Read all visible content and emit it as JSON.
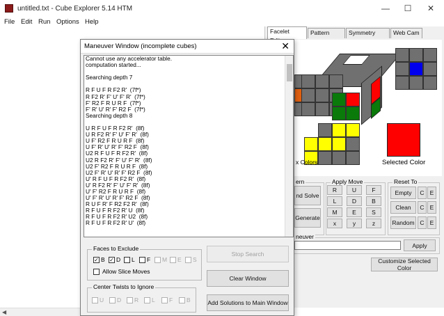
{
  "window": {
    "title": "untitled.txt - Cube Explorer 5.14 HTM",
    "min": "—",
    "max": "☐",
    "close": "✕"
  },
  "menu": [
    "File",
    "Edit",
    "Run",
    "Options",
    "Help"
  ],
  "tabs": [
    "Facelet Editor",
    "Pattern Editor",
    "Symmetry Editor",
    "Web Cam"
  ],
  "right": {
    "colors_label": "x Colors",
    "selected_color_label": "Selected Color",
    "selected_color": "#ff0000",
    "pattern_group": "ern",
    "solve_btn": "nd Solve",
    "generate_btn": "Generate",
    "apply_move_title": "Apply Move",
    "moves": [
      "R",
      "U",
      "F",
      "L",
      "D",
      "B",
      "M",
      "E",
      "S",
      "x",
      "y",
      "z"
    ],
    "reset_title": "Reset To",
    "reset_buttons": [
      "Empty",
      "Clean",
      "Random"
    ],
    "reset_side": [
      "C",
      "E"
    ],
    "maneuver_label": "neuver",
    "apply_btn": "Apply",
    "customize_btn": "Customize Selected Color"
  },
  "dialog": {
    "title": "Maneuver Window (incomplete cubes)",
    "close": "✕",
    "lines": [
      "Cannot use any accelerator table.",
      "computation started...",
      "",
      "Searching depth 7",
      "",
      "R F U F R F2 R'  (7f*)",
      "R F2 R' F' U' F' R'  (7f*)",
      "F' R2 F R U R F  (7f*)",
      "F' R' U' R' F' R2 F  (7f*)",
      "Searching depth 8",
      "",
      "U R F U F R F2 R'  (8f)",
      "U R F2 R' F' U' F' R'  (8f)",
      "U F' R2 F R U R F  (8f)",
      "U F' R' U' R' F' R2 F  (8f)",
      "U2 R F U F R F2 R'  (8f)",
      "U2 R F2 R' F' U' F' R'  (8f)",
      "U2 F' R2 F R U R F  (8f)",
      "U2 F' R' U' R' F' R2 F  (8f)",
      "U' R F U F R F2 R'  (8f)",
      "U' R F2 R' F' U' F' R'  (8f)",
      "U' F' R2 F R U R F  (8f)",
      "U' F' R' U' R' F' R2 F  (8f)",
      "R U F R' F R2 F2 R'  (8f)",
      "R F U F R F2 R' U  (8f)",
      "R F U F R F2 R' U2  (8f)",
      "R F U F R F2 R' U'  (8f)"
    ],
    "faces_title": "Faces to Exclude",
    "faces": [
      {
        "label": "B",
        "checked": true,
        "enabled": true
      },
      {
        "label": "D",
        "checked": true,
        "enabled": true
      },
      {
        "label": "L",
        "checked": false,
        "enabled": true
      },
      {
        "label": "F",
        "checked": false,
        "enabled": true
      },
      {
        "label": "M",
        "checked": false,
        "enabled": false
      },
      {
        "label": "E",
        "checked": false,
        "enabled": false
      },
      {
        "label": "S",
        "checked": false,
        "enabled": false
      }
    ],
    "allow_slice": "Allow Slice Moves",
    "center_title": "Center Twists to Ignore",
    "centers": [
      "U",
      "D",
      "R",
      "L",
      "F",
      "B"
    ],
    "stop_btn": "Stop Search",
    "clear_btn": "Clear Window",
    "add_btn": "Add Solutions to Main Window"
  }
}
